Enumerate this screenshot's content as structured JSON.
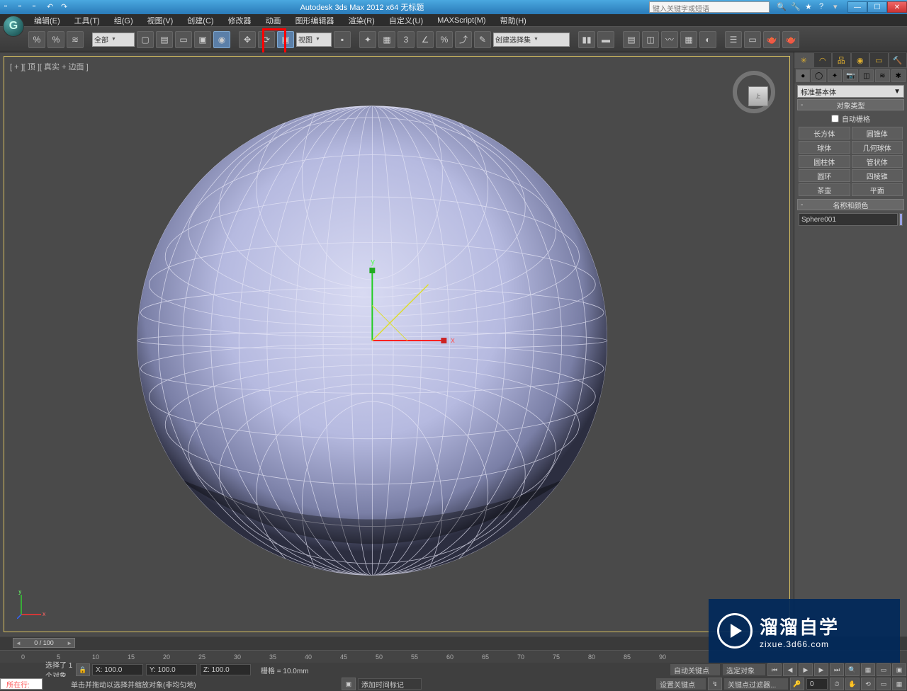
{
  "title": "Autodesk 3ds Max 2012 x64   无标题",
  "search_placeholder": "键入关键字或短语",
  "menu": [
    "编辑(E)",
    "工具(T)",
    "组(G)",
    "视图(V)",
    "创建(C)",
    "修改器",
    "动画",
    "图形编辑器",
    "渲染(R)",
    "自定义(U)",
    "MAXScript(M)",
    "帮助(H)"
  ],
  "toolbar": {
    "sel_filter": "全部",
    "ref_coord": "视图",
    "named_sel": "创建选择集"
  },
  "viewport": {
    "label": "[ + ][ 顶 ][ 真实 + 边面 ]"
  },
  "cmdpanel": {
    "category": "标准基本体",
    "rollout1": "对象类型",
    "autogrid": "自动栅格",
    "objects": [
      "长方体",
      "圆锥体",
      "球体",
      "几何球体",
      "圆柱体",
      "管状体",
      "圆环",
      "四棱锥",
      "茶壶",
      "平面"
    ],
    "rollout2": "名称和颜色",
    "objname": "Sphere001"
  },
  "timeslider": {
    "handle": "0 / 100"
  },
  "trackbar_ticks": [
    "0",
    "5",
    "10",
    "15",
    "20",
    "25",
    "30",
    "35",
    "40",
    "45",
    "50",
    "55",
    "60",
    "65",
    "70",
    "75",
    "80",
    "85",
    "90"
  ],
  "status": {
    "sel": "选择了 1 个对象",
    "prompt": "单击并拖动以选择并缩放对象(非均匀地)",
    "x": "X: 100.0",
    "y": "Y: 100.0",
    "z": "Z: 100.0",
    "grid": "栅格 = 10.0mm",
    "addtime": "添加时间标记",
    "autokey": "自动关键点",
    "setkey": "设置关键点",
    "keyfilter": "关键点过滤器...",
    "seltime": "选定对象",
    "row_label": "所在行:"
  },
  "watermark": {
    "big": "溜溜自学",
    "small": "zixue.3d66.com"
  }
}
